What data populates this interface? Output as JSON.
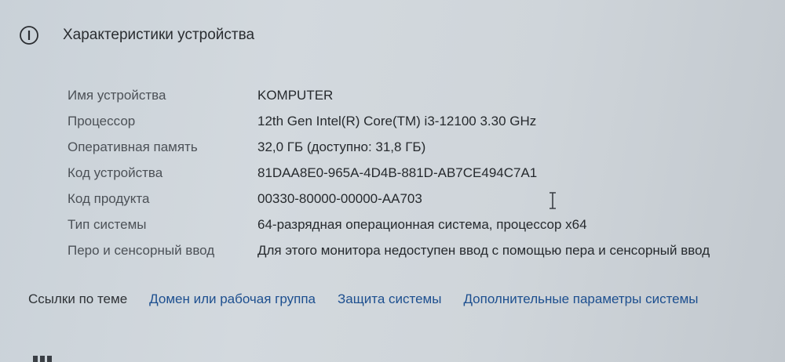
{
  "header": {
    "title": "Характеристики устройства",
    "icon": "info-icon"
  },
  "specs": [
    {
      "label": "Имя устройства",
      "value": "KOMPUTER"
    },
    {
      "label": "Процессор",
      "value": "12th Gen Intel(R) Core(TM) i3-12100   3.30 GHz"
    },
    {
      "label": "Оперативная память",
      "value": "32,0 ГБ (доступно: 31,8 ГБ)"
    },
    {
      "label": "Код устройства",
      "value": "81DAA8E0-965A-4D4B-881D-AB7CE494C7A1"
    },
    {
      "label": "Код продукта",
      "value": "00330-80000-00000-AA703"
    },
    {
      "label": "Тип системы",
      "value": "64-разрядная операционная система, процессор x64"
    },
    {
      "label": "Перо и сенсорный ввод",
      "value": "Для этого монитора недоступен ввод с помощью пера и сенсорный ввод"
    }
  ],
  "related_links": {
    "label": "Ссылки по теме",
    "items": [
      "Домен или рабочая группа",
      "Защита системы",
      "Дополнительные параметры системы"
    ]
  },
  "colors": {
    "link": "#1d4f8f",
    "label": "#4c5157",
    "value": "#262a2e"
  }
}
